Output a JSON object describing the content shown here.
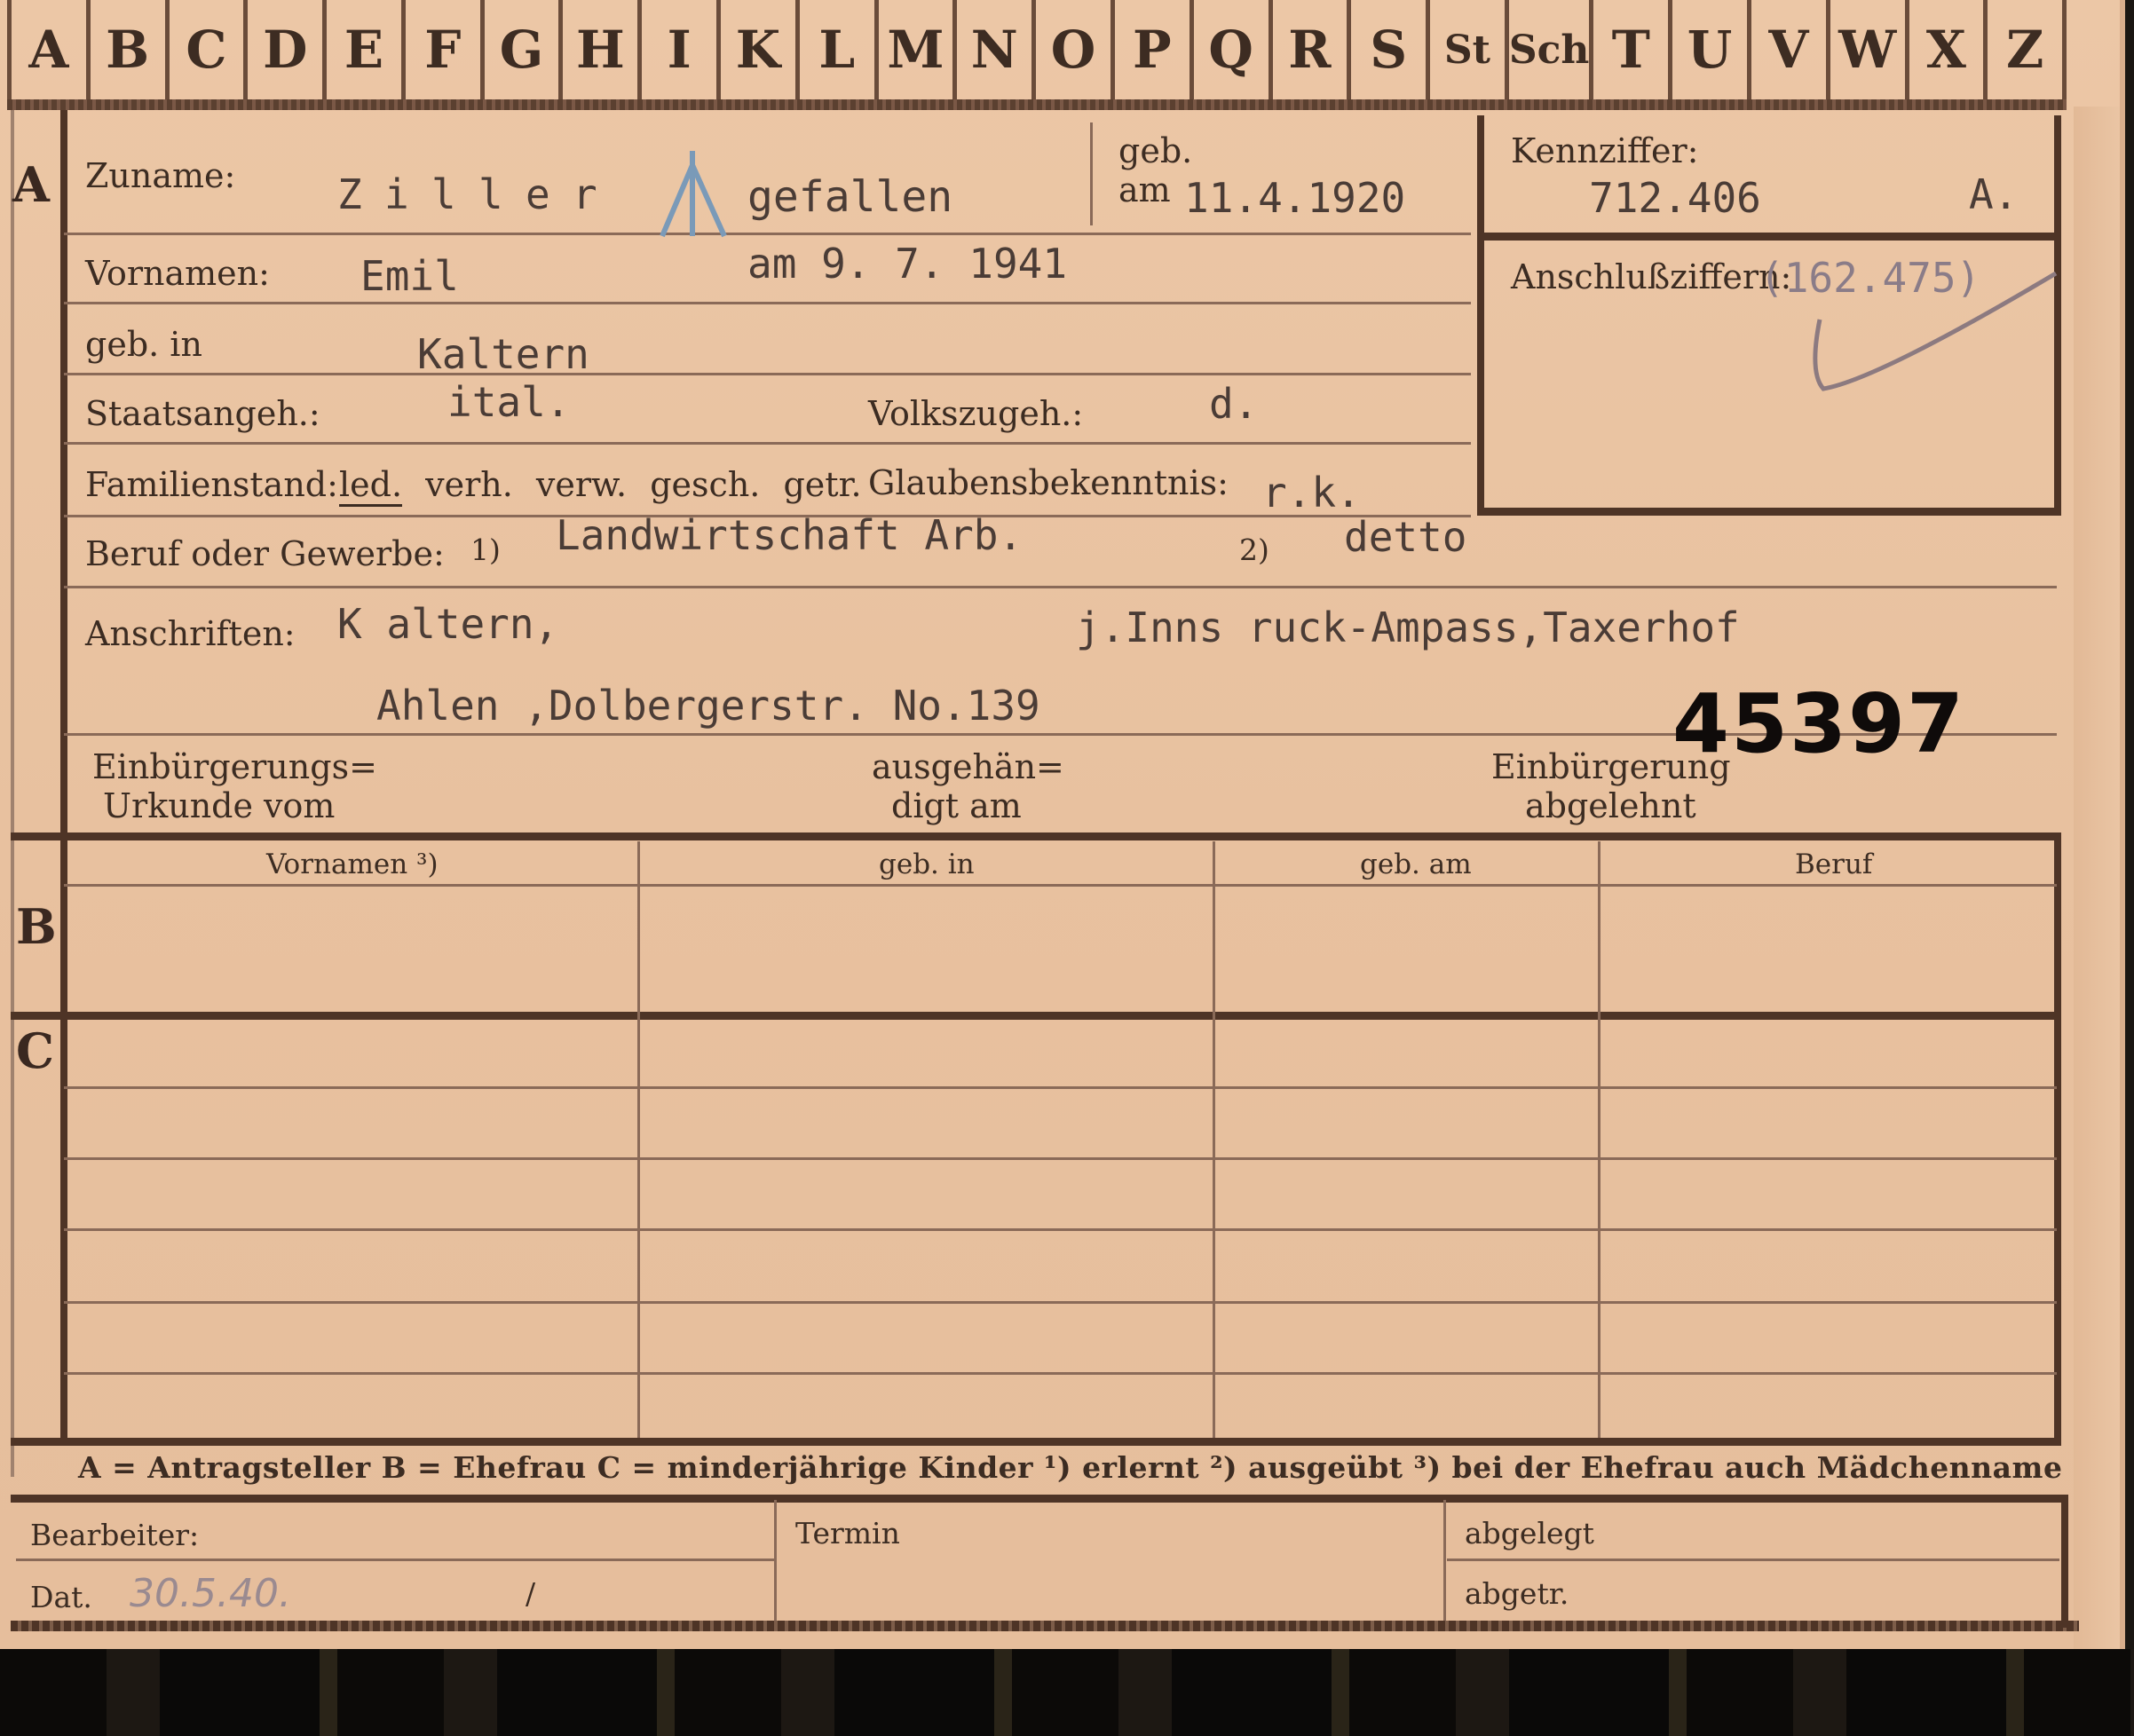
{
  "alphabet_tabs": [
    "A",
    "B",
    "C",
    "D",
    "E",
    "F",
    "G",
    "H",
    "I",
    "K",
    "L",
    "M",
    "N",
    "O",
    "P",
    "Q",
    "R",
    "S",
    "St",
    "Sch",
    "T",
    "U",
    "V",
    "W",
    "X",
    "Z"
  ],
  "sections": {
    "a": "A",
    "b": "B",
    "c": "C"
  },
  "section_a": {
    "surname_label": "Zuname:",
    "surname_value": "Ziller",
    "surname_note": "gefallen",
    "birth_label_top": "geb.",
    "birth_label_bottom": "am",
    "birth_date": "11.4.1920",
    "kennziffer_label": "Kennziffer:",
    "kennziffer_value": "712.406",
    "kennziffer_suffix": "A.",
    "anschluss_label": "Anschlußziffern:",
    "anschluss_value": "(162.475)",
    "forename_label": "Vornamen:",
    "forename_value": "Emil",
    "death_note": "am 9. 7. 1941",
    "birthplace_label": "geb. in",
    "birthplace_value": "Kaltern",
    "citizenship_label": "Staatsangeh.:",
    "citizenship_value": "ital.",
    "ethnicity_label": "Volkszugeh.:",
    "ethnicity_value": "d.",
    "marital_label": "Familienstand:",
    "marital_options": [
      "led.",
      "verh.",
      "verw.",
      "gesch.",
      "getr."
    ],
    "marital_selected": "led.",
    "religion_label": "Glaubensbekenntnis:",
    "religion_value": "r.k.",
    "profession_label": "Beruf oder Gewerbe:",
    "profession_note1": "1)",
    "profession_value1": "Landwirtschaft Arb.",
    "profession_note2": "2)",
    "profession_value2": "detto",
    "address_label": "Anschriften:",
    "address1": "K altern,",
    "address2": "j.Inns ruck-Ampass,Taxerhof",
    "address3": "Ahlen ,Dolbergerstr. No.139",
    "stamp_number": "45397",
    "naturalization_doc_label_1": "Einbürgerungs=",
    "naturalization_doc_label_2": "Urkunde vom",
    "handed_label_1": "ausgehän=",
    "handed_label_2": "digt am",
    "naturalization_rejected_1": "Einbürgerung",
    "naturalization_rejected_2": "abgelehnt"
  },
  "table": {
    "headers": [
      "Vornamen ³)",
      "geb. in",
      "geb. am",
      "Beruf"
    ]
  },
  "legend": {
    "text": "A = Antragsteller   B = Ehefrau   C = minderjährige Kinder   ¹) erlernt   ²) ausgeübt   ³) bei der Ehefrau auch Mädchenname"
  },
  "footer": {
    "processor_label": "Bearbeiter:",
    "date_label": "Dat.",
    "date_value": "30.5.40.",
    "slash": "/",
    "deadline_label": "Termin",
    "filed_label": "abgelegt",
    "delivered_label": "abgetr."
  },
  "colors": {
    "card": "#e8c19f",
    "ink": "#3c2c22",
    "typewriter": "#4a3c36",
    "stamp": "#0f0b0a",
    "pencil_blue": "#7a9ab8"
  }
}
